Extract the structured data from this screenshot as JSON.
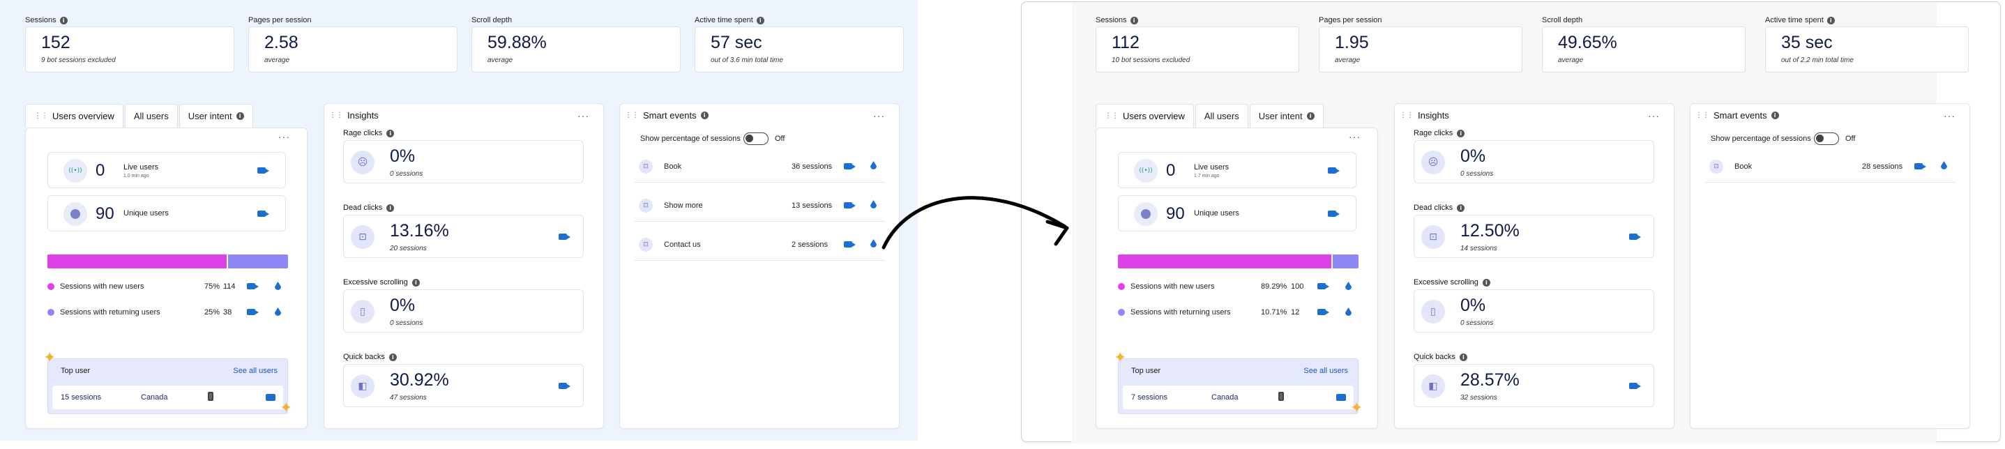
{
  "left": {
    "metrics": [
      {
        "label": "Sessions",
        "value": "152",
        "sub": "9 bot sessions excluded"
      },
      {
        "label": "Pages per session",
        "value": "2.58",
        "sub": "average"
      },
      {
        "label": "Scroll depth",
        "value": "59.88%",
        "sub": "average"
      },
      {
        "label": "Active time spent",
        "value": "57 sec",
        "sub": "out of 3.6 min total time"
      }
    ],
    "tabs": [
      "Users overview",
      "All users",
      "User intent"
    ],
    "live_users": {
      "value": "0",
      "label": "Live users",
      "sub": "1.0 min ago"
    },
    "unique_users": {
      "value": "90",
      "label": "Unique users"
    },
    "split": {
      "new_fraction": 0.75
    },
    "legend": [
      {
        "label": "Sessions with new users",
        "pct": "75%",
        "count": "114",
        "color": "#e040e8"
      },
      {
        "label": "Sessions with returning users",
        "pct": "25%",
        "count": "38",
        "color": "#8f87f5"
      }
    ],
    "top_user": {
      "title": "Top user",
      "link": "See all users",
      "sessions": "15 sessions",
      "country": "Canada"
    },
    "insights": {
      "title": "Insights",
      "items": [
        {
          "label": "Rage clicks",
          "value": "0%",
          "sub": "0 sessions",
          "video": false
        },
        {
          "label": "Dead clicks",
          "value": "13.16%",
          "sub": "20 sessions",
          "video": true
        },
        {
          "label": "Excessive scrolling",
          "value": "0%",
          "sub": "0 sessions",
          "video": false
        },
        {
          "label": "Quick backs",
          "value": "30.92%",
          "sub": "47 sessions",
          "video": true
        }
      ]
    },
    "smart_events": {
      "title": "Smart events",
      "toggle_label": "Show percentage of sessions",
      "toggle_state": "Off",
      "rows": [
        {
          "name": "Book",
          "count": "36 sessions"
        },
        {
          "name": "Show more",
          "count": "13 sessions"
        },
        {
          "name": "Contact us",
          "count": "2 sessions"
        }
      ]
    }
  },
  "right": {
    "metrics": [
      {
        "label": "Sessions",
        "value": "112",
        "sub": "10 bot sessions excluded"
      },
      {
        "label": "Pages per session",
        "value": "1.95",
        "sub": "average"
      },
      {
        "label": "Scroll depth",
        "value": "49.65%",
        "sub": "average"
      },
      {
        "label": "Active time spent",
        "value": "35 sec",
        "sub": "out of 2.2 min total time"
      }
    ],
    "tabs": [
      "Users overview",
      "All users",
      "User intent"
    ],
    "live_users": {
      "value": "0",
      "label": "Live users",
      "sub": "1.7 min ago"
    },
    "unique_users": {
      "value": "90",
      "label": "Unique users"
    },
    "split": {
      "new_fraction": 0.8929
    },
    "legend": [
      {
        "label": "Sessions with new users",
        "pct": "89.29%",
        "count": "100",
        "color": "#e040e8"
      },
      {
        "label": "Sessions with returning users",
        "pct": "10.71%",
        "count": "12",
        "color": "#8f87f5"
      }
    ],
    "top_user": {
      "title": "Top user",
      "link": "See all users",
      "sessions": "7 sessions",
      "country": "Canada"
    },
    "insights": {
      "title": "Insights",
      "items": [
        {
          "label": "Rage clicks",
          "value": "0%",
          "sub": "0 sessions",
          "video": false
        },
        {
          "label": "Dead clicks",
          "value": "12.50%",
          "sub": "14 sessions",
          "video": true
        },
        {
          "label": "Excessive scrolling",
          "value": "0%",
          "sub": "0 sessions",
          "video": false
        },
        {
          "label": "Quick backs",
          "value": "28.57%",
          "sub": "32 sessions",
          "video": true
        }
      ]
    },
    "smart_events": {
      "title": "Smart events",
      "toggle_label": "Show percentage of sessions",
      "toggle_state": "Off",
      "rows": [
        {
          "name": "Book",
          "count": "28 sessions"
        }
      ]
    }
  },
  "icons": {
    "arrow": "curved-arrow-right"
  }
}
